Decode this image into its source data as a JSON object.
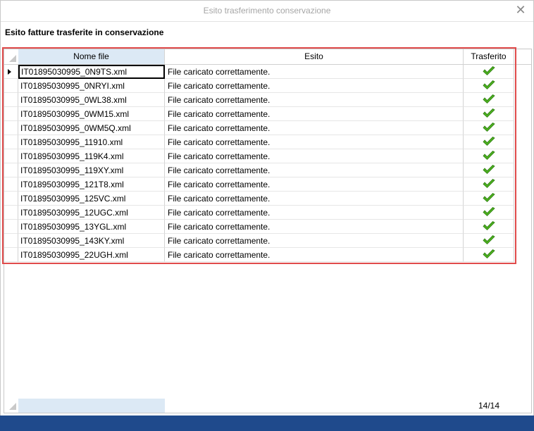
{
  "window": {
    "title": "Esito trasferimento conservazione",
    "close_icon": "close-icon"
  },
  "heading": "Esito fatture trasferite in conservazione",
  "grid": {
    "columns": [
      "Nome file",
      "Esito",
      "Trasferito"
    ],
    "rows": [
      {
        "file": "IT01895030995_0N9TS.xml",
        "esito": "File caricato correttamente.",
        "trasferito": true
      },
      {
        "file": "IT01895030995_0NRYI.xml",
        "esito": "File caricato correttamente.",
        "trasferito": true
      },
      {
        "file": "IT01895030995_0WL38.xml",
        "esito": "File caricato correttamente.",
        "trasferito": true
      },
      {
        "file": "IT01895030995_0WM15.xml",
        "esito": "File caricato correttamente.",
        "trasferito": true
      },
      {
        "file": "IT01895030995_0WM5Q.xml",
        "esito": "File caricato correttamente.",
        "trasferito": true
      },
      {
        "file": "IT01895030995_11910.xml",
        "esito": "File caricato correttamente.",
        "trasferito": true
      },
      {
        "file": "IT01895030995_119K4.xml",
        "esito": "File caricato correttamente.",
        "trasferito": true
      },
      {
        "file": "IT01895030995_119XY.xml",
        "esito": "File caricato correttamente.",
        "trasferito": true
      },
      {
        "file": "IT01895030995_121T8.xml",
        "esito": "File caricato correttamente.",
        "trasferito": true
      },
      {
        "file": "IT01895030995_125VC.xml",
        "esito": "File caricato correttamente.",
        "trasferito": true
      },
      {
        "file": "IT01895030995_12UGC.xml",
        "esito": "File caricato correttamente.",
        "trasferito": true
      },
      {
        "file": "IT01895030995_13YGL.xml",
        "esito": "File caricato correttamente.",
        "trasferito": true
      },
      {
        "file": "IT01895030995_143KY.xml",
        "esito": "File caricato correttamente.",
        "trasferito": true
      },
      {
        "file": "IT01895030995_22UGH.xml",
        "esito": "File caricato correttamente.",
        "trasferito": true
      }
    ],
    "footer_count": "14/14"
  },
  "colors": {
    "highlight": "#e04b4b",
    "check": "#4caf1f",
    "selected_column": "#dce9f5",
    "bottom_bar": "#1f4a8c"
  }
}
